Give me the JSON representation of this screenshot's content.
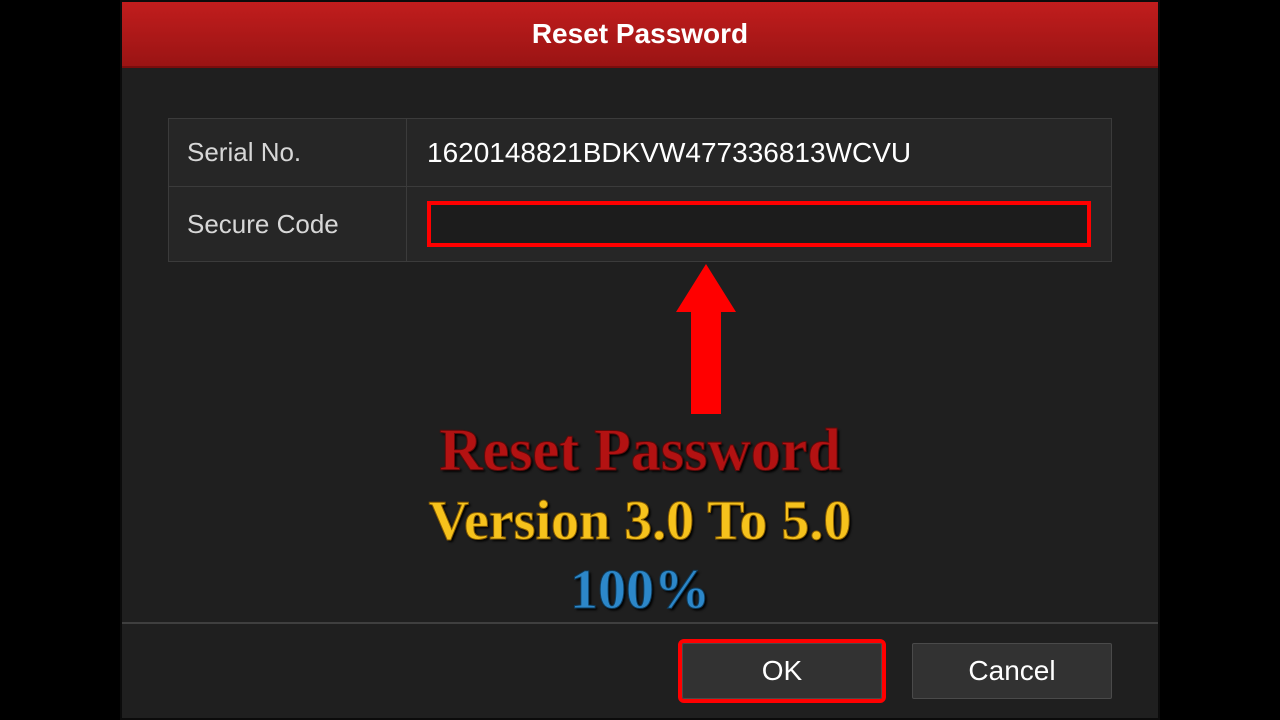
{
  "window": {
    "title": "Reset Password"
  },
  "form": {
    "serial_label": "Serial No.",
    "serial_value": "1620148821BDKVW477336813WCVU",
    "secure_label": "Secure Code",
    "secure_value": ""
  },
  "annotation": {
    "line1": "Reset Password",
    "line2": "Version 3.0 To 5.0",
    "line3": "100%"
  },
  "buttons": {
    "ok": "OK",
    "cancel": "Cancel"
  }
}
